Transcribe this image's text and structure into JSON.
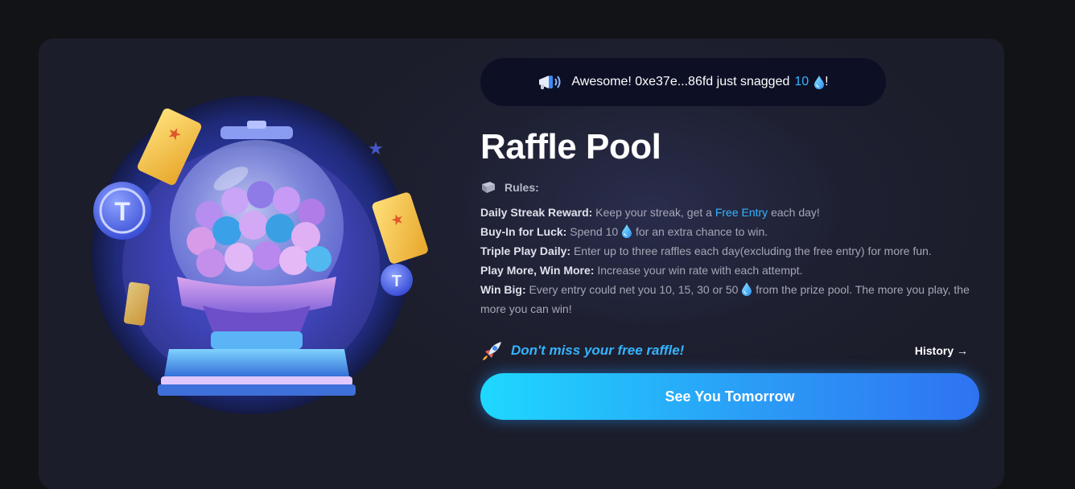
{
  "ticker": {
    "icon": "megaphone-icon",
    "prefix": "Awesome! 0xe37e...86fd just snagged",
    "amount": "10",
    "currency_icon": "water-drop-icon",
    "suffix": "!"
  },
  "title": "Raffle Pool",
  "rules": {
    "icon": "book-icon",
    "heading": "Rules:",
    "items": [
      {
        "label": "Daily Streak Reward:",
        "text_before": " Keep your streak, get a ",
        "highlight": "Free Entry",
        "text_after": " each day!"
      },
      {
        "label": "Buy-In for Luck:",
        "text_before": " Spend 10 ",
        "text_after": " for an extra chance to win."
      },
      {
        "label": "Triple Play Daily:",
        "text": " Enter up to three raffles each day(excluding the free entry) for more fun."
      },
      {
        "label": "Play More, Win More:",
        "text": " Increase your win rate with each attempt."
      },
      {
        "label": "Win Big:",
        "text_before": " Every entry could net you 10, 15, 30 or 50 ",
        "text_after": " from the prize pool. The more you play, the more you can win!"
      }
    ]
  },
  "promo": {
    "icon": "rocket-icon",
    "text": "Don't miss your free raffle!"
  },
  "history_link": "History →",
  "main_button": "See You Tomorrow",
  "colors": {
    "accent": "#35b4ff",
    "button_start": "#1ed8ff",
    "button_end": "#2f72f2",
    "card_bg": "#1b1d2a",
    "page_bg": "#121317"
  }
}
